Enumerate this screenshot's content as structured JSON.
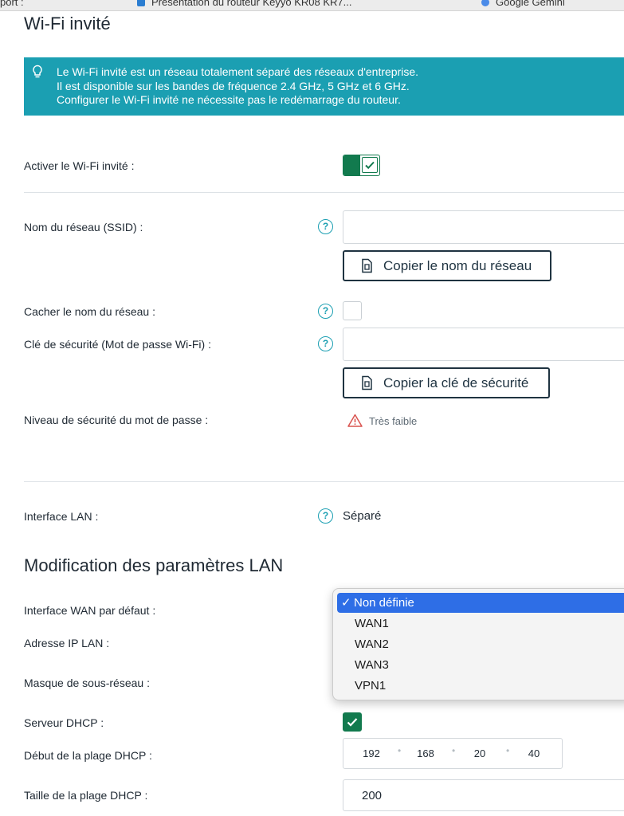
{
  "bookmarks": [
    {
      "label": "port :",
      "icon": "bookmark-icon"
    },
    {
      "label": "Présentation du routeur Keyyo KR08 KR7...",
      "icon": "page-icon"
    },
    {
      "label": "Google Gemini",
      "icon": "gemini-icon"
    }
  ],
  "page_title": "Wi-Fi invité",
  "info": {
    "icon": "lightbulb-icon",
    "lines": [
      "Le Wi-Fi invité est un réseau totalement séparé des réseaux d'entreprise.",
      "Il est disponible sur les bandes de fréquence 2.4 GHz, 5 GHz et 6 GHz.",
      "Configurer le Wi-Fi invité ne nécessite pas le redémarrage du routeur."
    ]
  },
  "fields": {
    "enable_label": "Activer le Wi-Fi invité :",
    "enable_on": true,
    "ssid_label": "Nom du réseau (SSID) :",
    "ssid_value": "",
    "copy_ssid_label": "Copier le nom du réseau",
    "hide_label": "Cacher le nom du réseau :",
    "hide_checked": false,
    "key_label": "Clé de sécurité (Mot de passe Wi-Fi) :",
    "key_value": "",
    "copy_key_label": "Copier la clé de sécurité",
    "strength_label": "Niveau de sécurité du mot de passe :",
    "strength_value": "Très faible",
    "lan_label": "Interface LAN :",
    "lan_value": "Séparé"
  },
  "lan_section": {
    "title": "Modification des paramètres LAN",
    "wan_label": "Interface WAN par défaut :",
    "ip_label": "Adresse IP LAN :",
    "mask_label": "Masque de sous-réseau :",
    "dhcp_label": "Serveur DHCP :",
    "dhcp_checked": true,
    "dhcp_start_label": "Début de la plage DHCP :",
    "dhcp_start": [
      "192",
      "168",
      "20",
      "40"
    ],
    "dhcp_size_label": "Taille de la plage DHCP :",
    "dhcp_size": "200"
  },
  "wan_dropdown": {
    "selected_mark": "✓",
    "options": [
      "Non définie",
      "WAN1",
      "WAN2",
      "WAN3",
      "VPN1"
    ],
    "selected_index": 0
  },
  "help_glyph": "?",
  "colors": {
    "accent": "#1b9fb2",
    "toggle_green": "#127a4e",
    "warning": "#d9534f",
    "dropdown_highlight": "#2e6ee6"
  }
}
